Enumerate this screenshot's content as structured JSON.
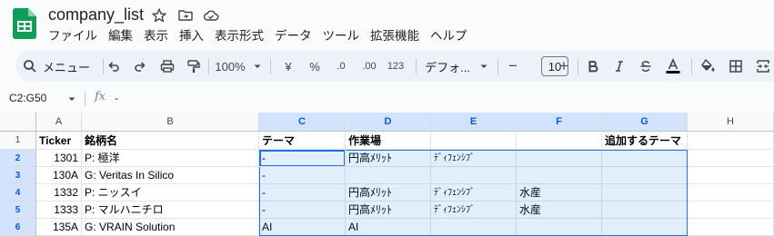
{
  "window": {
    "title": "company_list",
    "menu": [
      "ファイル",
      "編集",
      "表示",
      "挿入",
      "表示形式",
      "データ",
      "ツール",
      "拡張機能",
      "ヘルプ"
    ]
  },
  "toolbar": {
    "search_label": "メニュー",
    "zoom": "100%",
    "currency": "¥",
    "percent": "%",
    "decrease_decimal": ".0",
    "increase_decimal": ".00",
    "number_format": "123",
    "font": "デフォ...",
    "font_size": "10",
    "minus": "−",
    "plus": "+"
  },
  "formula_bar": {
    "name_box": "C2:G50",
    "fx": "fx",
    "value": "-"
  },
  "sheet": {
    "columns": [
      "A",
      "B",
      "C",
      "D",
      "E",
      "F",
      "G",
      "H"
    ],
    "row_numbers": [
      "1",
      "2",
      "3",
      "4",
      "5",
      "6"
    ],
    "rows": [
      [
        "Ticker",
        "銘柄名",
        "テーマ",
        "作業場",
        "",
        "",
        "追加するテーマ",
        ""
      ],
      [
        "1301",
        "P: 極洋",
        "-",
        "円高ﾒﾘｯﾄ",
        "ﾃﾞｨﾌｪﾝｼﾌﾞ",
        "",
        "",
        ""
      ],
      [
        "130A",
        "G: Veritas In Silico",
        "-",
        "",
        "",
        "",
        "",
        ""
      ],
      [
        "1332",
        "P: ニッスイ",
        "-",
        "円高ﾒﾘｯﾄ",
        "ﾃﾞｨﾌｪﾝｼﾌﾞ",
        "水産",
        "",
        ""
      ],
      [
        "1333",
        "P: マルハニチロ",
        "-",
        "円高ﾒﾘｯﾄ",
        "ﾃﾞｨﾌｪﾝｼﾌﾞ",
        "水産",
        "",
        ""
      ],
      [
        "135A",
        "G: VRAIN Solution",
        "AI",
        "AI",
        "",
        "",
        "",
        ""
      ]
    ]
  },
  "colors": {
    "sheets_green": "#0f9d58",
    "selection_blue": "#1a73e8",
    "header_selected": "#d3e3fd"
  }
}
